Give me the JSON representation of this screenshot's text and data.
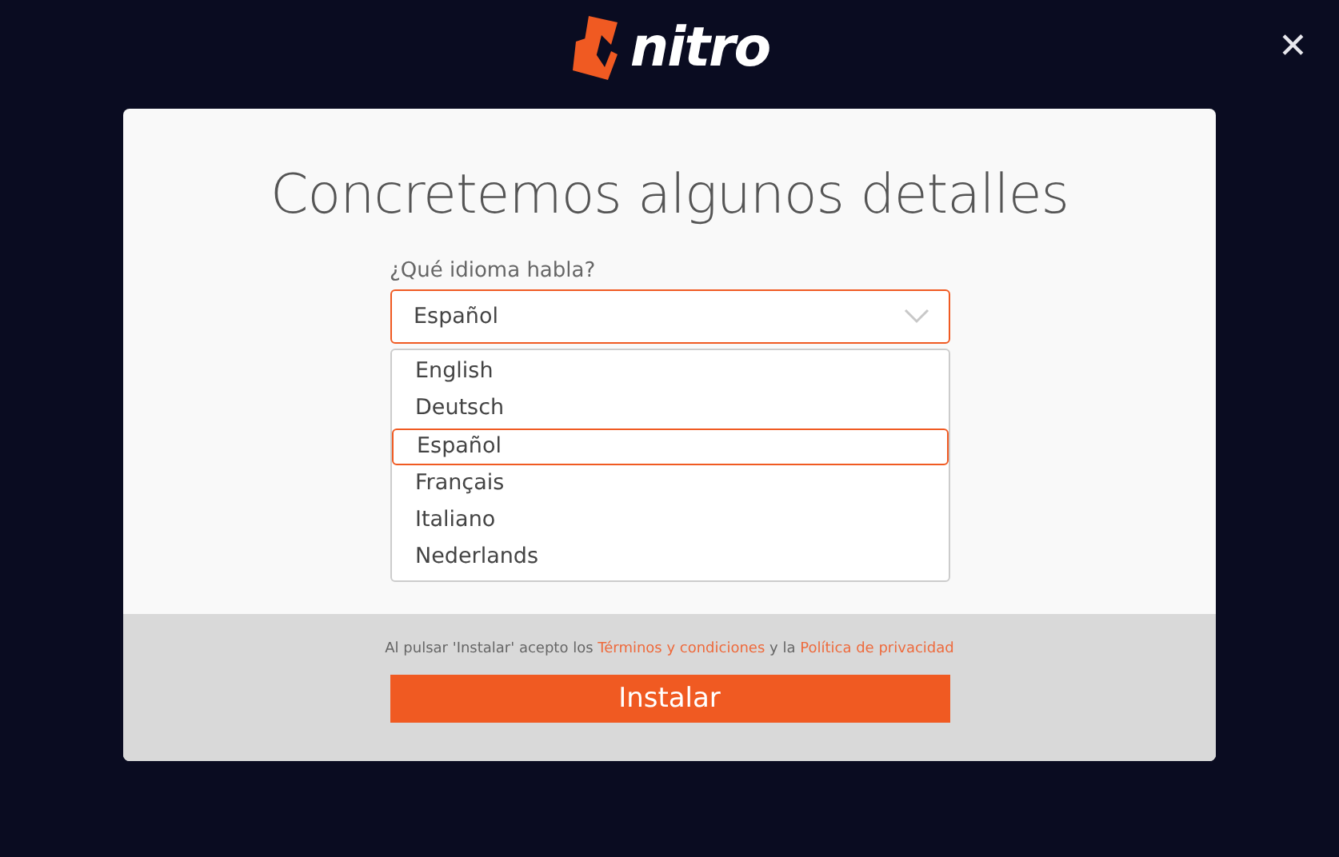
{
  "logo": {
    "text": "nitro"
  },
  "close": {
    "text": "✕"
  },
  "card": {
    "title": "Concretemos algunos detalles",
    "language": {
      "label": "¿Qué idioma habla?",
      "value": "Español",
      "expanded": true,
      "options": [
        {
          "label": "English",
          "selected": false
        },
        {
          "label": "Deutsch",
          "selected": false
        },
        {
          "label": "Español",
          "selected": true
        },
        {
          "label": "Français",
          "selected": false
        },
        {
          "label": "Italiano",
          "selected": false
        },
        {
          "label": "Nederlands",
          "selected": false
        }
      ]
    },
    "legal": {
      "before": "Al pulsar 'Instalar' acepto los",
      "link1": "Términos y condiciones",
      "middle": "y la",
      "link2": "Política de privacidad"
    },
    "install_button": "Instalar"
  }
}
